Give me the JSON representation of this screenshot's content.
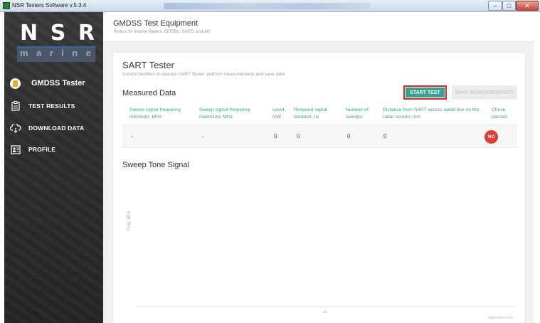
{
  "window": {
    "title": "NSR Testers Software v.5.3.4",
    "controls": {
      "minimize": "–",
      "maximize": "□",
      "close": "✕"
    }
  },
  "sidebar": {
    "logo": {
      "letters": [
        "N",
        "S",
        "R"
      ],
      "sub": [
        "m",
        "a",
        "r",
        "i",
        "n",
        "e"
      ]
    },
    "items": [
      {
        "label": "GMDSS Tester",
        "icon": "gmdss-tester-icon",
        "active": true
      },
      {
        "label": "TEST RESULTS",
        "icon": "clipboard-icon"
      },
      {
        "label": "DOWNLOAD DATA",
        "icon": "cloud-download-icon"
      },
      {
        "label": "PROFILE",
        "icon": "profile-card-icon"
      }
    ]
  },
  "header": {
    "title": "GMDSS Test Equipment",
    "subtitle": "Testers for Marine Radios, EPIRBs, SARTs and AIS"
  },
  "main": {
    "title": "SART Tester",
    "subtitle": "Control facilities to operate SART Tester, perform measurements and save data",
    "measured_title": "Measured Data",
    "buttons": {
      "start": "START TEST",
      "save": "SAVE MEASUREMENTS"
    },
    "table": {
      "headers": [
        [
          "Sweep signal frequency",
          "minimum, MHz"
        ],
        [
          "Sweep signal frequency",
          "maximum, MHz"
        ],
        [
          "Level,",
          "mW"
        ],
        [
          "Respond signal",
          "duration, us"
        ],
        [
          "Number of",
          "sweeps"
        ],
        [
          "Distance from SART across radial line on the",
          "radar screen, nmi"
        ],
        [
          "Check",
          "passed"
        ]
      ],
      "row": [
        "-",
        "-",
        "0",
        "0",
        "0",
        "0"
      ],
      "check": "NO"
    },
    "sweep_title": "Sweep Tone Signal"
  },
  "chart_data": {
    "type": "line",
    "title": "",
    "xlabel": "us",
    "ylabel": "Freq, MHz",
    "series": [],
    "grid": false,
    "credit": "Highcharts.com"
  },
  "colors": {
    "accent": "#3a9f91",
    "fail": "#e23b30",
    "highlight": "#d62b2b",
    "sidebar": "#2f2f2f"
  }
}
